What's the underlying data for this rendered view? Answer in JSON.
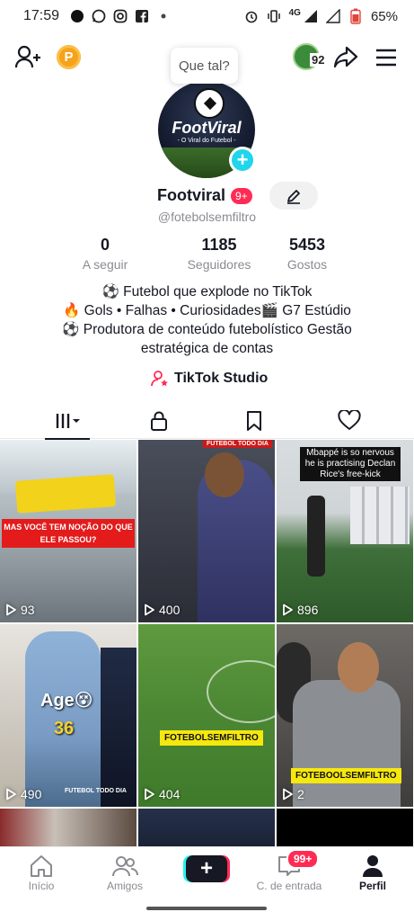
{
  "status_bar": {
    "time": "17:59",
    "network": "4G",
    "battery": "65%",
    "icons": [
      "dot-icon",
      "whatsapp-icon",
      "instagram-icon",
      "facebook-icon",
      "alarm-icon",
      "vibrate-icon",
      "signal-icon",
      "battery-icon"
    ]
  },
  "top_bar": {
    "tooltip": "Que tal?",
    "stories_count": "92"
  },
  "avatar": {
    "brand": "FootViral",
    "tagline": "- O Viral do Futebol -"
  },
  "profile": {
    "display_name": "Footviral",
    "name_badge": "9+",
    "username": "@fotebolsemfiltro"
  },
  "stats": [
    {
      "value": "0",
      "label": "A seguir"
    },
    {
      "value": "1185",
      "label": "Seguidores"
    },
    {
      "value": "5453",
      "label": "Gostos"
    }
  ],
  "bio": {
    "line1": "⚽ Futebol que explode no TikTok",
    "line2": "🔥 Gols • Falhas • Curiosidades🎬 G7 Estúdio",
    "line3": "⚽ Produtora de conteúdo futebolístico Gestão",
    "line4": "estratégica de contas"
  },
  "studio_link": "TikTok Studio",
  "tabs": [
    "videos",
    "private",
    "saved",
    "liked"
  ],
  "videos": [
    {
      "views": "93",
      "overlay": "MAS VOCÊ TEM NOÇÃO DO QUE ELE PASSOU?"
    },
    {
      "views": "400",
      "overlay": "FUTEBOL TODO DIA"
    },
    {
      "views": "896",
      "overlay": "Mbappé is so nervous he is practising Declan Rice's free-kick"
    },
    {
      "views": "490",
      "overlay": "Age😵",
      "overlay2": "36",
      "overlay3": "FUTEBOL TODO DIA"
    },
    {
      "views": "404",
      "overlay": "FOTEBOLSEMFILTRO"
    },
    {
      "views": "2",
      "overlay": "FOTEBOOLSEMFILTRO"
    }
  ],
  "bottom_nav": {
    "home": "Início",
    "friends": "Amigos",
    "inbox": "C. de entrada",
    "inbox_badge": "99+",
    "profile": "Perfil"
  },
  "colors": {
    "accent_red": "#fe2c55",
    "accent_cyan": "#20d5ec",
    "text_primary": "#161823",
    "text_secondary": "#8a8b91"
  }
}
